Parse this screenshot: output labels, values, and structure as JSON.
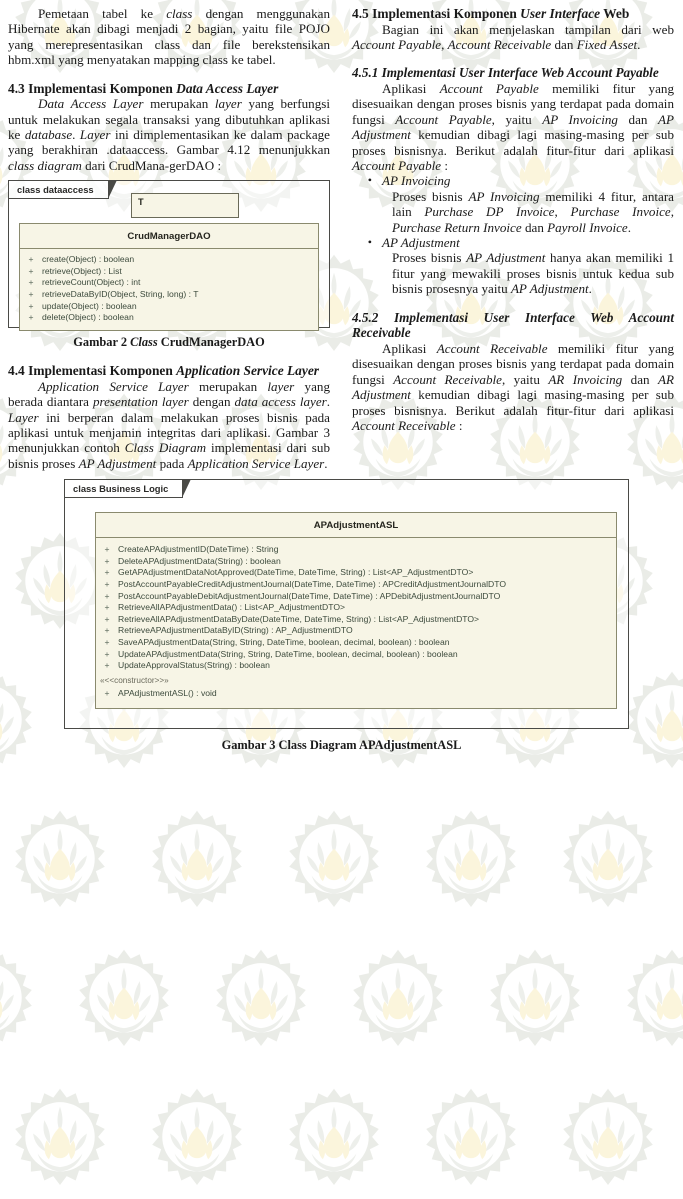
{
  "document": {
    "language": "id",
    "watermark_icon": "its-gear-lotus-logo"
  },
  "left_column": {
    "intro_paragraph": "Pemetaan tabel ke class dengan menggunakan Hibernate akan dibagi menjadi 2 bagian, yaitu file POJO yang merepresentasikan class dan file berekstensikan hbm.xml yang menyatakan mapping class ke tabel.",
    "section_4_3": {
      "number": "4.3",
      "title_plain_1": "Implementasi Komponen ",
      "title_italic": "Data Access Layer",
      "body": "Data Access Layer merupakan layer yang berfungsi untuk melakukan segala transaksi yang dibutuhkan aplikasi ke database. Layer ini dimplementasikan ke dalam package yang berakhiran .dataaccess. Gambar 4.12 menunjukkan class diagram dari CrudMana-gerDAO :"
    },
    "figure_2": {
      "frame_label": "class dataaccess",
      "type_parameter": "T",
      "class_name": "CrudManagerDAO",
      "methods": [
        {
          "visibility": "+",
          "signature": "create(Object) : boolean"
        },
        {
          "visibility": "+",
          "signature": "retrieve(Object) : List"
        },
        {
          "visibility": "+",
          "signature": "retrieveCount(Object) : int"
        },
        {
          "visibility": "+",
          "signature": "retrieveDataByID(Object, String, long) : T"
        },
        {
          "visibility": "+",
          "signature": "update(Object) : boolean"
        },
        {
          "visibility": "+",
          "signature": "delete(Object) : boolean"
        }
      ],
      "caption_1": "Gambar 2 ",
      "caption_italic": "Class",
      "caption_2": " CrudManagerDAO"
    },
    "section_4_4": {
      "number": "4.4",
      "title_plain_1": "Implementasi Komponen ",
      "title_italic": "Application Service Layer",
      "body": "Application Service Layer merupakan layer yang berada diantara presentation layer dengan data access layer. Layer ini berperan dalam melakukan proses bisnis pada aplikasi untuk menjamin integritas dari aplikasi. Gambar 3 menunjukkan contoh Class Diagram implementasi dari sub bisnis proses AP Adjustment pada Application Service Layer."
    }
  },
  "right_column": {
    "section_4_5": {
      "number": "4.5",
      "title_plain_1": "Implementasi Komponen ",
      "title_italic": "User Interface",
      "title_plain_2": " Web",
      "body": "Bagian ini akan menjelaskan tampilan dari web Account Payable, Account Receivable dan Fixed Asset."
    },
    "section_4_5_1": {
      "number": "4.5.1",
      "title": "Implementasi User Interface Web Account Payable",
      "body": "Aplikasi Account Payable memiliki fitur yang disesuaikan dengan proses bisnis yang terdapat pada domain fungsi Account Payable, yaitu AP Invoicing dan AP Adjustment kemudian dibagi lagi masing-masing per sub proses bisnisnya. Berikut adalah fitur-fitur dari aplikasi Account Payable :",
      "bullets": [
        {
          "marker": "•",
          "heading": "AP Invoicing",
          "body": "Proses bisnis AP Invoicing memiliki 4 fitur, antara lain Purchase DP Invoice, Purchase Invoice, Purchase Return Invoice dan Payroll Invoice."
        },
        {
          "marker": "•",
          "heading": "AP Adjustment",
          "body": "Proses bisnis AP Adjustment hanya akan memiliki 1 fitur yang mewakili proses bisnis untuk kedua sub bisnis prosesnya yaitu AP Adjustment."
        }
      ]
    },
    "section_4_5_2": {
      "number": "4.5.2",
      "title": "Implementasi User Interface Web Account Receivable",
      "body": "Aplikasi Account Receivable memiliki fitur yang disesuaikan dengan proses bisnis yang terdapat pada domain fungsi Account Receivable, yaitu AR Invoicing dan AR Adjustment kemudian dibagi lagi masing-masing per sub proses bisnisnya. Berikut adalah fitur-fitur dari aplikasi Account Receivable :"
    }
  },
  "figure_3": {
    "frame_label": "class Business Logic",
    "class_name": "APAdjustmentASL",
    "methods": [
      {
        "visibility": "+",
        "signature": "CreateAPAdjustmentID(DateTime) : String"
      },
      {
        "visibility": "+",
        "signature": "DeleteAPAdjustmentData(String) : boolean"
      },
      {
        "visibility": "+",
        "signature": "GetAPAdjustmentDataNotApproved(DateTime, DateTime, String) : List<AP_AdjustmentDTO>"
      },
      {
        "visibility": "+",
        "signature": "PostAccountPayableCreditAdjustmentJournal(DateTime, DateTime) : APCreditAdjustmentJournalDTO"
      },
      {
        "visibility": "+",
        "signature": "PostAccountPayableDebitAdjustmentJournal(DateTime, DateTime) : APDebitAdjustmentJournalDTO"
      },
      {
        "visibility": "+",
        "signature": "RetrieveAllAPAdjustmentData() : List<AP_AdjustmentDTO>"
      },
      {
        "visibility": "+",
        "signature": "RetrieveAllAPAdjustmentDataByDate(DateTime, DateTime, String) : List<AP_AdjustmentDTO>"
      },
      {
        "visibility": "+",
        "signature": "RetrieveAPAdjustmentDataByID(String) : AP_AdjustmentDTO"
      },
      {
        "visibility": "+",
        "signature": "SaveAPAdjustmentData(String, String, DateTime, boolean, decimal, boolean) : boolean"
      },
      {
        "visibility": "+",
        "signature": "UpdateAPAdjustmentData(String, String, DateTime, boolean, decimal, boolean) : boolean"
      },
      {
        "visibility": "+",
        "signature": "UpdateApprovalStatus(String) : boolean"
      }
    ],
    "stereotype": "«<<constructor>>»",
    "constructor": {
      "visibility": "+",
      "signature": "APAdjustmentASL() : void"
    },
    "caption": "Gambar 3 Class Diagram APAdjustmentASL"
  }
}
